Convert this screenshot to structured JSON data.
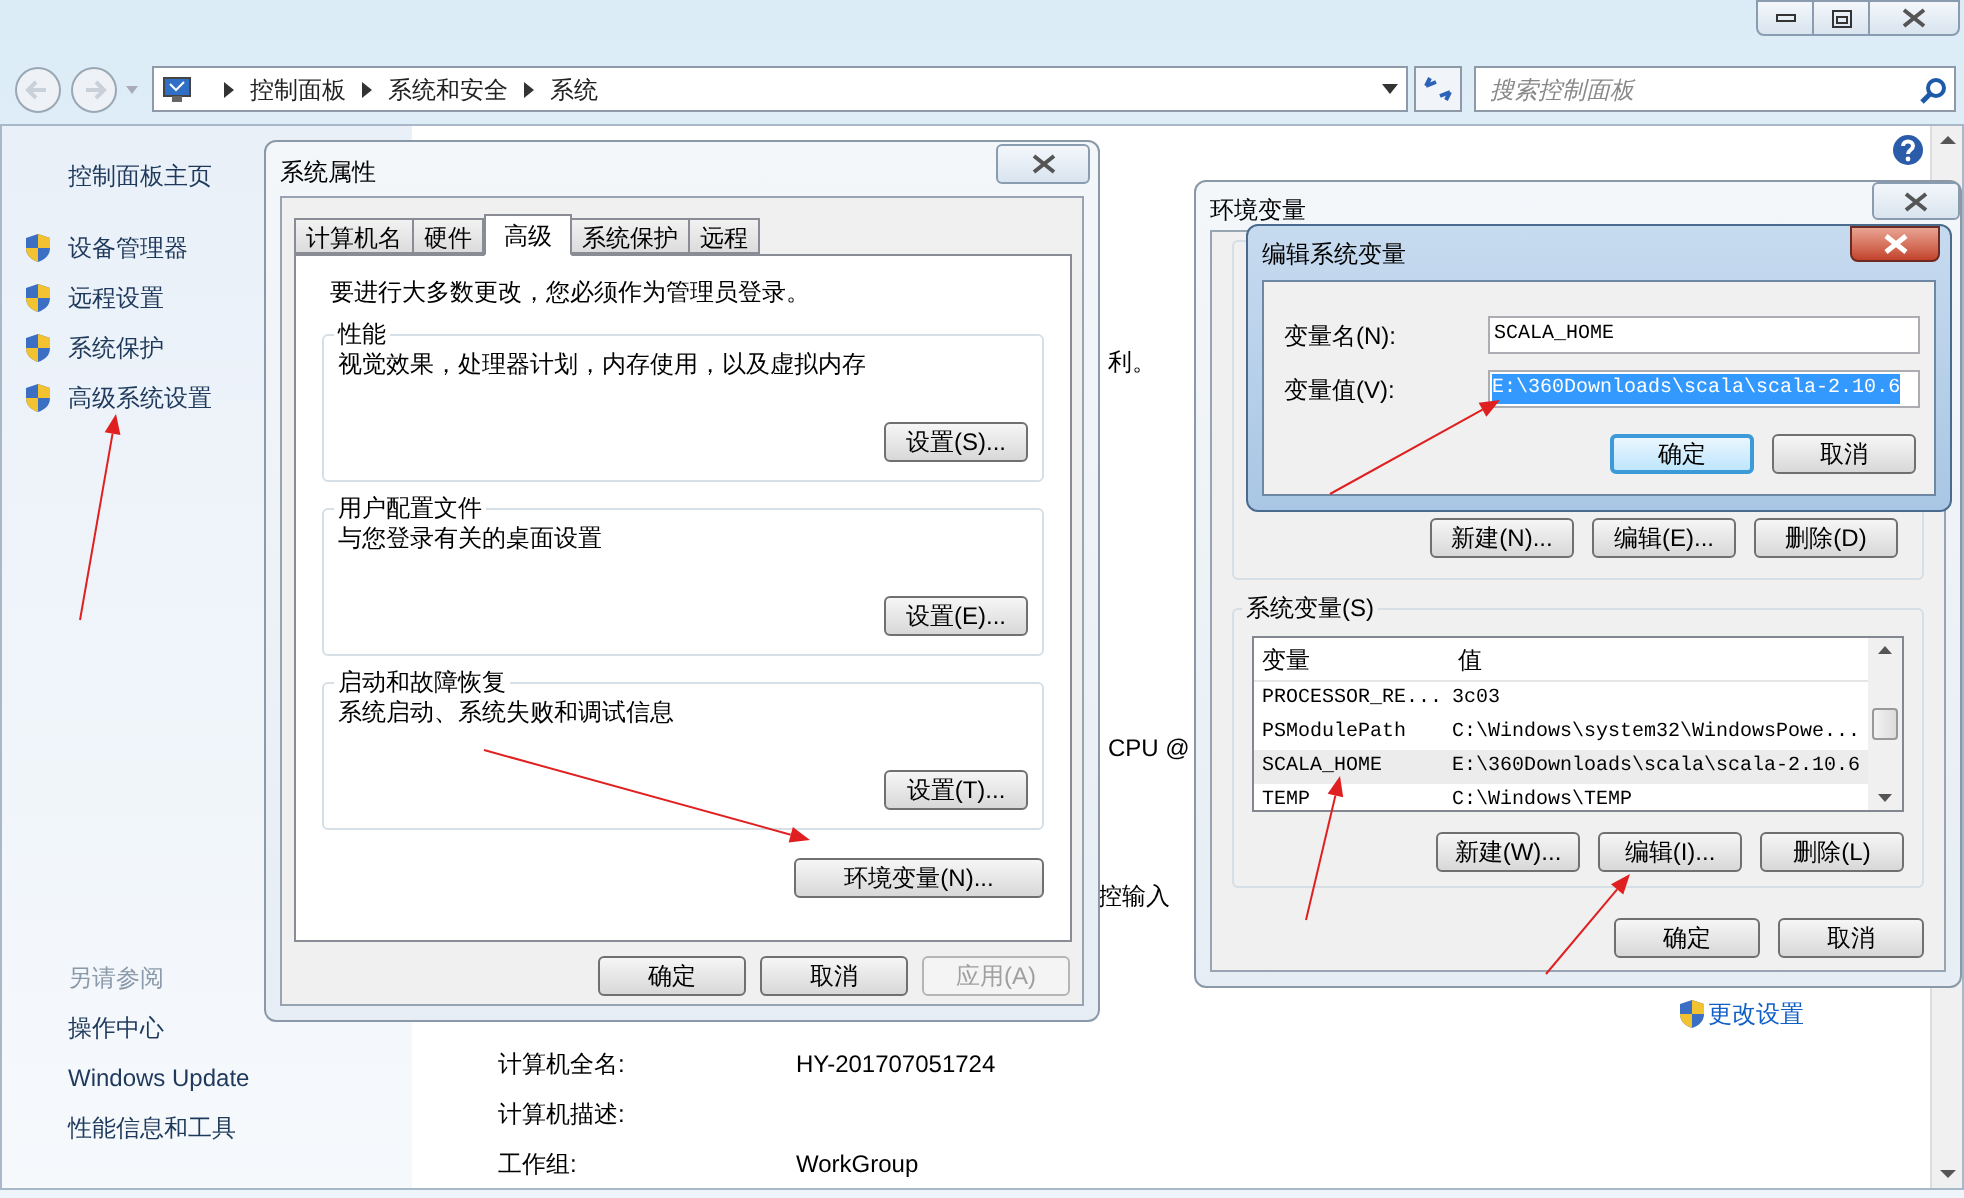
{
  "explorer": {
    "breadcrumb": [
      "控制面板",
      "系统和安全",
      "系统"
    ],
    "search_placeholder": "搜索控制面板",
    "sidebar": {
      "home": "控制面板主页",
      "tasks": [
        "设备管理器",
        "远程设置",
        "系统保护",
        "高级系统设置"
      ],
      "see_also_title": "另请参阅",
      "see_also": [
        "操作中心",
        "Windows Update",
        "性能信息和工具"
      ]
    },
    "content": {
      "fragments": [
        "利。",
        "CPU @",
        "控输入"
      ],
      "info_rows": [
        {
          "label": "计算机全名:",
          "value": "HY-201707051724"
        },
        {
          "label": "计算机描述:"
        },
        {
          "label": "工作组:",
          "value": "WorkGroup"
        }
      ],
      "change_settings": "更改设置"
    }
  },
  "system_properties": {
    "title": "系统属性",
    "tabs": [
      {
        "label": "计算机名",
        "selected": false
      },
      {
        "label": "硬件",
        "selected": false
      },
      {
        "label": "高级",
        "selected": true
      },
      {
        "label": "系统保护",
        "selected": false
      },
      {
        "label": "远程",
        "selected": false
      }
    ],
    "note": "要进行大多数更改，您必须作为管理员登录。",
    "groups": [
      {
        "title": "性能",
        "description": "视觉效果，处理器计划，内存使用，以及虚拟内存",
        "button": "设置(S)..."
      },
      {
        "title": "用户配置文件",
        "description": "与您登录有关的桌面设置",
        "button": "设置(E)..."
      },
      {
        "title": "启动和故障恢复",
        "description": "系统启动、系统失败和调试信息",
        "button": "设置(T)..."
      }
    ],
    "env_button": "环境变量(N)...",
    "buttons": [
      {
        "label": "确定",
        "disabled": false
      },
      {
        "label": "取消",
        "disabled": false
      },
      {
        "label": "应用(A)",
        "disabled": true
      }
    ]
  },
  "environment_variables": {
    "title": "环境变量",
    "user_buttons": [
      "新建(N)...",
      "编辑(E)...",
      "删除(D)"
    ],
    "system_group": "系统变量(S)",
    "columns": [
      "变量",
      "值"
    ],
    "rows": [
      {
        "name": "PROCESSOR_RE...",
        "value": "3c03",
        "selected": false
      },
      {
        "name": "PSModulePath",
        "value": "C:\\Windows\\system32\\WindowsPowe...",
        "selected": false
      },
      {
        "name": "SCALA_HOME",
        "value": "E:\\360Downloads\\scala\\scala-2.10.6",
        "selected": true
      },
      {
        "name": "TEMP",
        "value": "C:\\Windows\\TEMP",
        "selected": false
      }
    ],
    "system_buttons": [
      "新建(W)...",
      "编辑(I)...",
      "删除(L)"
    ],
    "buttons": [
      "确定",
      "取消"
    ]
  },
  "edit_dialog": {
    "title": "编辑系统变量",
    "fields": [
      {
        "label": "变量名(N):",
        "value": "SCALA_HOME",
        "text_selected": false
      },
      {
        "label": "变量值(V):",
        "value": "E:\\360Downloads\\scala\\scala-2.10.6",
        "text_selected": true
      }
    ],
    "buttons": [
      {
        "label": "确定",
        "focused": true
      },
      {
        "label": "取消",
        "focused": false
      }
    ]
  }
}
